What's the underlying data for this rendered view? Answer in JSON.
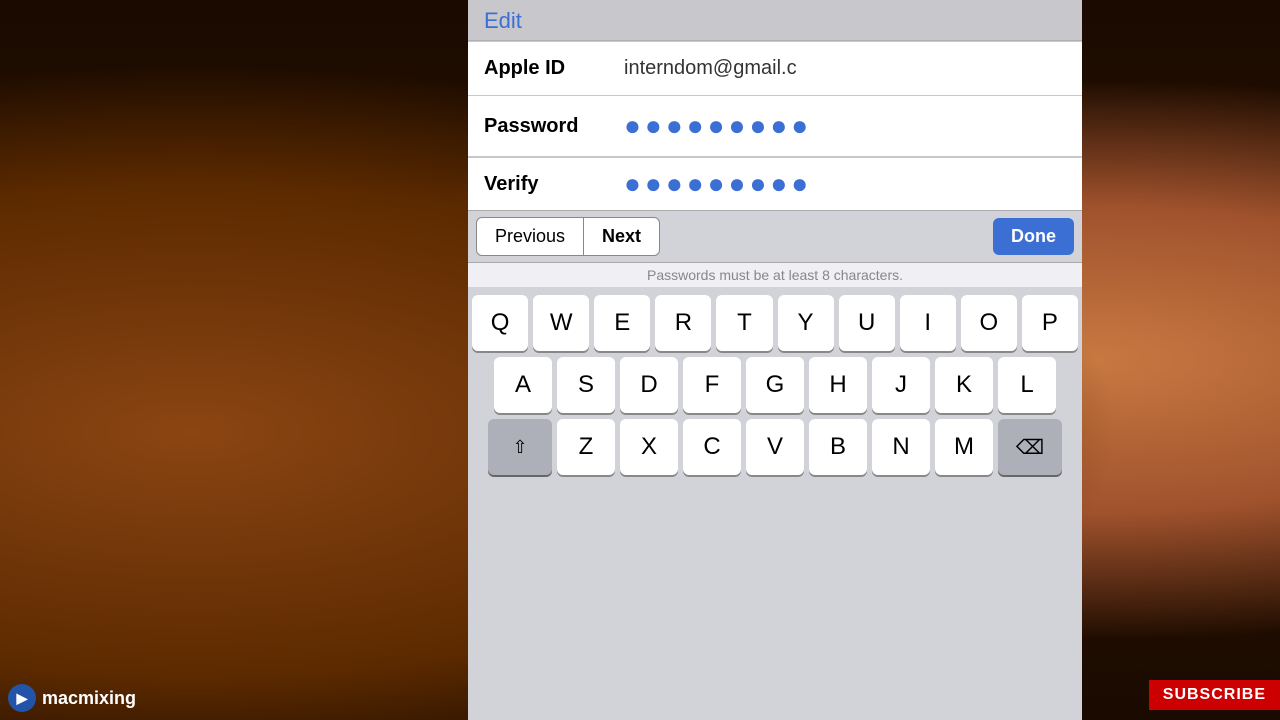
{
  "background": {
    "color": "#1a0a00"
  },
  "header": {
    "edit_label": "Edit"
  },
  "form": {
    "apple_id_label": "Apple ID",
    "apple_id_value": "interndom@gmail.c",
    "password_label": "Password",
    "password_dots": "●●●●●●●●●",
    "verify_label": "Verify",
    "verify_dots": "●●●●●●●●●"
  },
  "toolbar": {
    "previous_label": "Previous",
    "next_label": "Next",
    "done_label": "Done"
  },
  "hint": {
    "text": "Passwords must be at least 8 characters."
  },
  "keyboard": {
    "row1": [
      "Q",
      "W",
      "E",
      "R",
      "T",
      "Y",
      "U",
      "I",
      "O",
      "P"
    ],
    "row2": [
      "A",
      "S",
      "D",
      "F",
      "G",
      "H",
      "J",
      "K",
      "L"
    ],
    "row3": [
      "Z",
      "X",
      "C",
      "V",
      "B",
      "N",
      "M"
    ]
  },
  "logo": {
    "text": "macmixing"
  },
  "subscribe": {
    "label": "SUBSCRIBE"
  }
}
